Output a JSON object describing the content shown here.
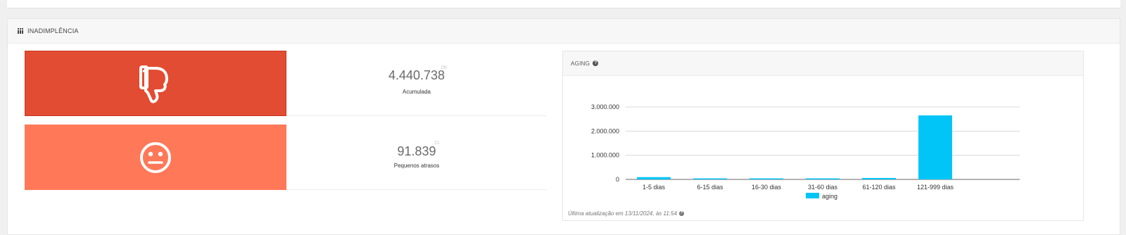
{
  "panel": {
    "title": "INADIMPLÊNCIA",
    "icon": "bar-grid-icon"
  },
  "stats": [
    {
      "value": "4.440.738",
      "sup": "09",
      "label": "Acumulada",
      "icon": "thumbs-down-icon",
      "color": "#e24c32"
    },
    {
      "value": "91.839",
      "sup": "21",
      "label": "Pequenos atrasos",
      "icon": "neutral-face-icon",
      "color": "#ff7858"
    }
  ],
  "aging": {
    "title": "AGING",
    "help_icon": "question-circle-icon",
    "updated_text": "Última atualização em 13/11/2024, às 11:54"
  },
  "chart_data": {
    "type": "bar",
    "categories": [
      "1-5 dias",
      "6-15 dias",
      "16-30 dias",
      "31-60 dias",
      "61-120 dias",
      "121-999 dias"
    ],
    "series": [
      {
        "name": "aging",
        "values": [
          95000,
          8000,
          4000,
          22000,
          60000,
          2650000
        ],
        "color": "#00c5f6"
      }
    ],
    "y_ticks": [
      "3.000.000",
      "2.000.000",
      "1.000.000",
      "0"
    ],
    "ylim": [
      0,
      3000000
    ],
    "grid": true,
    "legend": "bottom"
  }
}
